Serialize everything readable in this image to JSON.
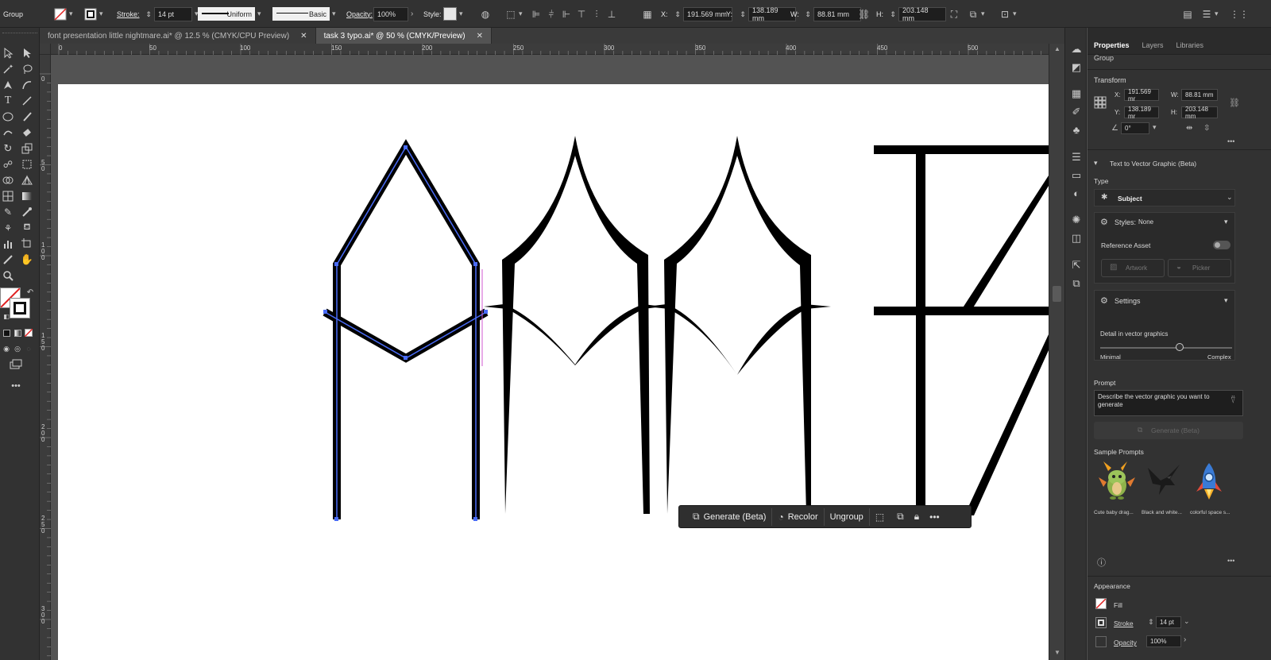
{
  "control_bar": {
    "selection_type": "Group",
    "stroke_label": "Stroke:",
    "stroke_weight": "14 pt",
    "stroke_profile": "Uniform",
    "brush": "Basic",
    "opacity_label": "Opacity:",
    "opacity": "100%",
    "style_label": "Style:",
    "x_label": "X:",
    "x_value": "191.569 mm",
    "y_label": "Y:",
    "y_value": "138.189 mm",
    "w_label": "W:",
    "w_value": "88.81 mm",
    "h_label": "H:",
    "h_value": "203.148 mm"
  },
  "tabs": [
    {
      "label": "font presentation little nightmare.ai* @ 12.5 % (CMYK/CPU Preview)"
    },
    {
      "label": "task 3 typo.ai* @ 50 % (CMYK/Preview)"
    }
  ],
  "ruler": {
    "h_ticks": [
      "0",
      "50",
      "100",
      "150",
      "200",
      "250",
      "300",
      "350",
      "400",
      "450",
      "500"
    ],
    "v_ticks": [
      "0",
      "50",
      "100",
      "150",
      "200",
      "250",
      "300"
    ]
  },
  "context_bar": {
    "generate": "Generate (Beta)",
    "recolor": "Recolor",
    "ungroup": "Ungroup"
  },
  "panel": {
    "tabs": [
      "Properties",
      "Layers",
      "Libraries"
    ],
    "selection": "Group",
    "transform_title": "Transform",
    "x_label": "X:",
    "x_value": "191.569 mr",
    "y_label": "Y:",
    "y_value": "138.189 mr",
    "w_label": "W:",
    "w_value": "88.81 mm",
    "h_label": "H:",
    "h_value": "203.148 mm",
    "angle": "0°",
    "t2v_title": "Text to Vector Graphic (Beta)",
    "type_label": "Type",
    "type_value": "Subject",
    "styles_label": "Styles:",
    "styles_value": "None",
    "reference_asset": "Reference Asset",
    "artwork": "Artwork",
    "picker": "Picker",
    "settings": "Settings",
    "detail_label": "Detail in vector graphics",
    "detail_min": "Minimal",
    "detail_max": "Complex",
    "detail_level": 0.6,
    "prompt_label": "Prompt",
    "prompt_placeholder": "Describe the vector graphic you want to generate",
    "generate_button": "Generate (Beta)",
    "sample_prompts_label": "Sample Prompts",
    "samples": [
      "Cute baby drag...",
      "Black and white...",
      "colorful space s..."
    ],
    "appearance_title": "Appearance",
    "fill_label": "Fill",
    "stroke_label": "Stroke",
    "stroke_value": "14 pt",
    "opacity_label": "Opacity",
    "opacity_value": "100%"
  }
}
